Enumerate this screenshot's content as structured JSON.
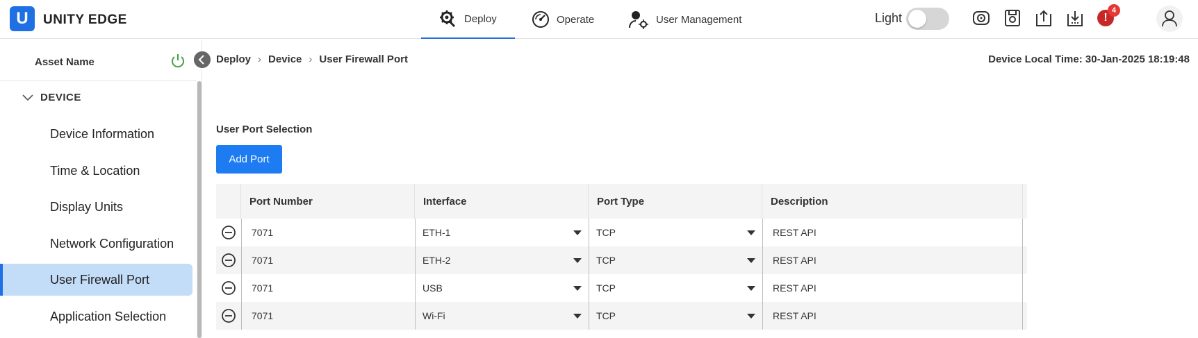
{
  "app": {
    "logo_letter": "U",
    "title": "UNITY EDGE"
  },
  "nav": {
    "tabs": [
      {
        "label": "Deploy"
      },
      {
        "label": "Operate"
      },
      {
        "label": "User Management"
      }
    ]
  },
  "toolbar": {
    "theme_label": "Light",
    "alert_symbol": "!",
    "alert_count": "4",
    "icons": [
      "disk-sync-icon",
      "save-icon",
      "upload-icon",
      "download-icon",
      "alert-icon",
      "user-avatar-icon"
    ]
  },
  "sidebar": {
    "asset_label": "Asset Name",
    "section": "DEVICE",
    "items": [
      {
        "label": "Device Information"
      },
      {
        "label": "Time & Location"
      },
      {
        "label": "Display Units"
      },
      {
        "label": "Network Configuration"
      },
      {
        "label": "User Firewall Port"
      },
      {
        "label": "Application Selection"
      }
    ],
    "active_item": "User Firewall Port"
  },
  "breadcrumb": [
    "Deploy",
    "Device",
    "User Firewall Port"
  ],
  "device_time": "Device Local Time: 30-Jan-2025 18:19:48",
  "main": {
    "section_title": "User Port Selection",
    "add_button": "Add Port",
    "table": {
      "headers": [
        "Port Number",
        "Interface",
        "Port Type",
        "Description"
      ],
      "rows": [
        {
          "port": "7071",
          "interface": "ETH-1",
          "type": "TCP",
          "description": "REST API"
        },
        {
          "port": "7071",
          "interface": "ETH-2",
          "type": "TCP",
          "description": "REST API"
        },
        {
          "port": "7071",
          "interface": "USB",
          "type": "TCP",
          "description": "REST API"
        },
        {
          "port": "7071",
          "interface": "Wi-Fi",
          "type": "TCP",
          "description": "REST API"
        }
      ]
    }
  },
  "colors": {
    "accent": "#1f6fe5",
    "active_item_bg": "#c3dcf8",
    "alert": "#c62828"
  }
}
